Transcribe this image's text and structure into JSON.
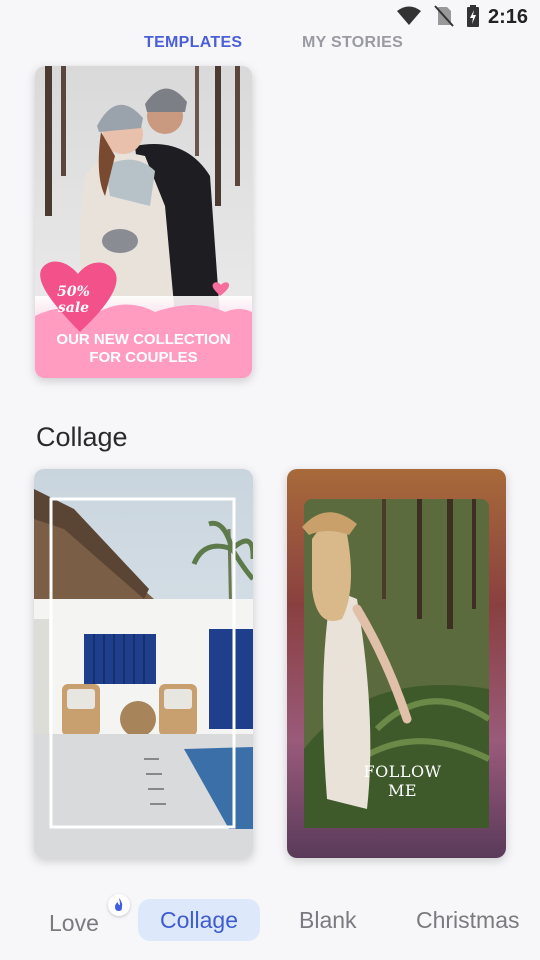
{
  "status": {
    "time": "2:16"
  },
  "tabs": [
    {
      "label": "TEMPLATES",
      "active": true
    },
    {
      "label": "MY STORIES",
      "active": false
    }
  ],
  "love_card": {
    "badge_line1": "50%",
    "badge_line2": "sale",
    "caption_line1": "OUR NEW COLLECTION",
    "caption_line2": "FOR COUPLES"
  },
  "sections": {
    "collage_title": "Collage"
  },
  "collage_cards": {
    "follow_line1": "FOLLOW",
    "follow_line2": "ME"
  },
  "categories": [
    {
      "label": "Love",
      "active": false,
      "badge": "fire-icon"
    },
    {
      "label": "Collage",
      "active": true
    },
    {
      "label": "Blank",
      "active": false
    },
    {
      "label": "Christmas",
      "active": false
    }
  ],
  "colors": {
    "accent": "#4a5fd8",
    "pink": "#f2518a",
    "chip_bg": "#dde8fb"
  }
}
